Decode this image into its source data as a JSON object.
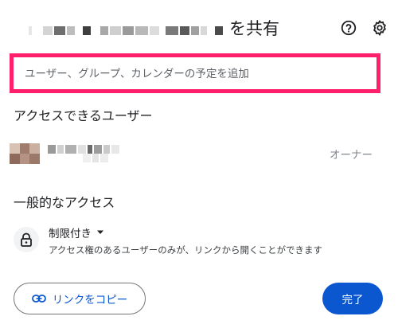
{
  "dialog": {
    "title_suffix": "を共有"
  },
  "add_people": {
    "placeholder": "ユーザー、グループ、カレンダーの予定を追加"
  },
  "people_section": {
    "heading": "アクセスできるユーザー",
    "people": [
      {
        "role": "オーナー"
      }
    ]
  },
  "general_access": {
    "heading": "一般的なアクセス",
    "selected": "制限付き",
    "description": "アクセス権のあるユーザーのみが、リンクから開くことができます"
  },
  "footer": {
    "copy_link_label": "リンクをコピー",
    "done_label": "完了"
  },
  "colors": {
    "highlight_border": "#ff1f6b",
    "primary_blue": "#0b57d0",
    "secondary_text": "#80868b"
  },
  "icons": {
    "help": "help-circle-icon",
    "settings": "gear-icon",
    "lock": "lock-icon",
    "dropdown": "caret-down-icon",
    "link": "link-icon"
  }
}
